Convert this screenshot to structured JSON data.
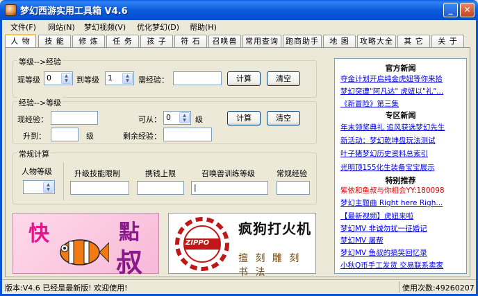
{
  "window": {
    "title": "梦幻西游实用工具箱 V4.6",
    "minimize_label": "_",
    "close_label": "✕"
  },
  "menu": [
    "文件(F)",
    "网站(N)",
    "梦幻视频(V)",
    "优化梦幻(D)",
    "帮助(H)"
  ],
  "tabs": [
    "人 物",
    "技 能",
    "修 炼",
    "任 务",
    "孩 子",
    "符 石",
    "召唤兽",
    "常用查询",
    "跑商助手",
    "地 图",
    "攻略大全",
    "其 它",
    "关 于"
  ],
  "exp_group": {
    "title": "等级-->经验",
    "current_level_label": "现等级",
    "current_level_value": "0",
    "to_level_label": "到等级",
    "to_level_value": "1",
    "need_exp_label": "需经验：",
    "need_exp_value": "",
    "calc_label": "计算",
    "clear_label": "清空"
  },
  "level_group": {
    "title": "经验-->等级",
    "current_exp_label": "现经验：",
    "current_exp_value": "",
    "can_from_label": "可从：",
    "can_from_value": "0",
    "level_unit": "级",
    "upgrade_to_label": "升到：",
    "upgrade_to_value": "",
    "upgrade_unit": "级",
    "remaining_exp_label": "剩余经验：",
    "remaining_exp_value": "",
    "calc_label": "计算",
    "clear_label": "清空"
  },
  "common_group": {
    "title": "常规计算",
    "char_level_label": "人物等级",
    "skill_limit_label": "升级技能限制",
    "money_limit_label": "携钱上限",
    "pet_level_label": "召唤兽训练等级",
    "normal_exp_label": "常规经验"
  },
  "banners": {
    "left_char1": "快",
    "left_char2": "點",
    "left_char3": "叔",
    "right_title": "疯狗打火机",
    "right_brand": "ZIPPO",
    "right_sub": "擅 刻 雕 刻 书 法"
  },
  "news": {
    "official_title": "官方新闻",
    "official_items": [
      "夺金计划开启纯金虎妞等你来拾",
      "梦幻突遭\"阿凡达\" 虎妞以\"礼\"...",
      "《新冒险》第三集"
    ],
    "zone_title": "专区新闻",
    "zone_items": [
      "年末领奖典礼 追风获选梦幻先生",
      "新活动：梦幻乾坤盘玩法测试",
      "叶子猪梦幻历史资料总索引",
      "光明顶155化生装备宝宝展示"
    ],
    "special_title": "特别推荐",
    "special_items": [
      "紫依和鱼叔与你相会YY:180098",
      "梦幻主题曲 Right here Righ...",
      "【最新视频】虎妞来啦",
      "梦幻MV 非诚勿扰一征婚记",
      "梦幻MV 屠帮",
      "梦幻MV 鱼叔的搞笑回忆录",
      "小秋Q币手工发货 交易联系卖家"
    ]
  },
  "status": {
    "left": "版本:V4.6 已经是最新版! 欢迎使用!",
    "right": "使用次数:49260207"
  },
  "colors": {
    "titlebar": "#0b5cdb",
    "link": "#0000ee",
    "special_red": "#d40000",
    "tab_active_accent": "#ffc83c"
  }
}
